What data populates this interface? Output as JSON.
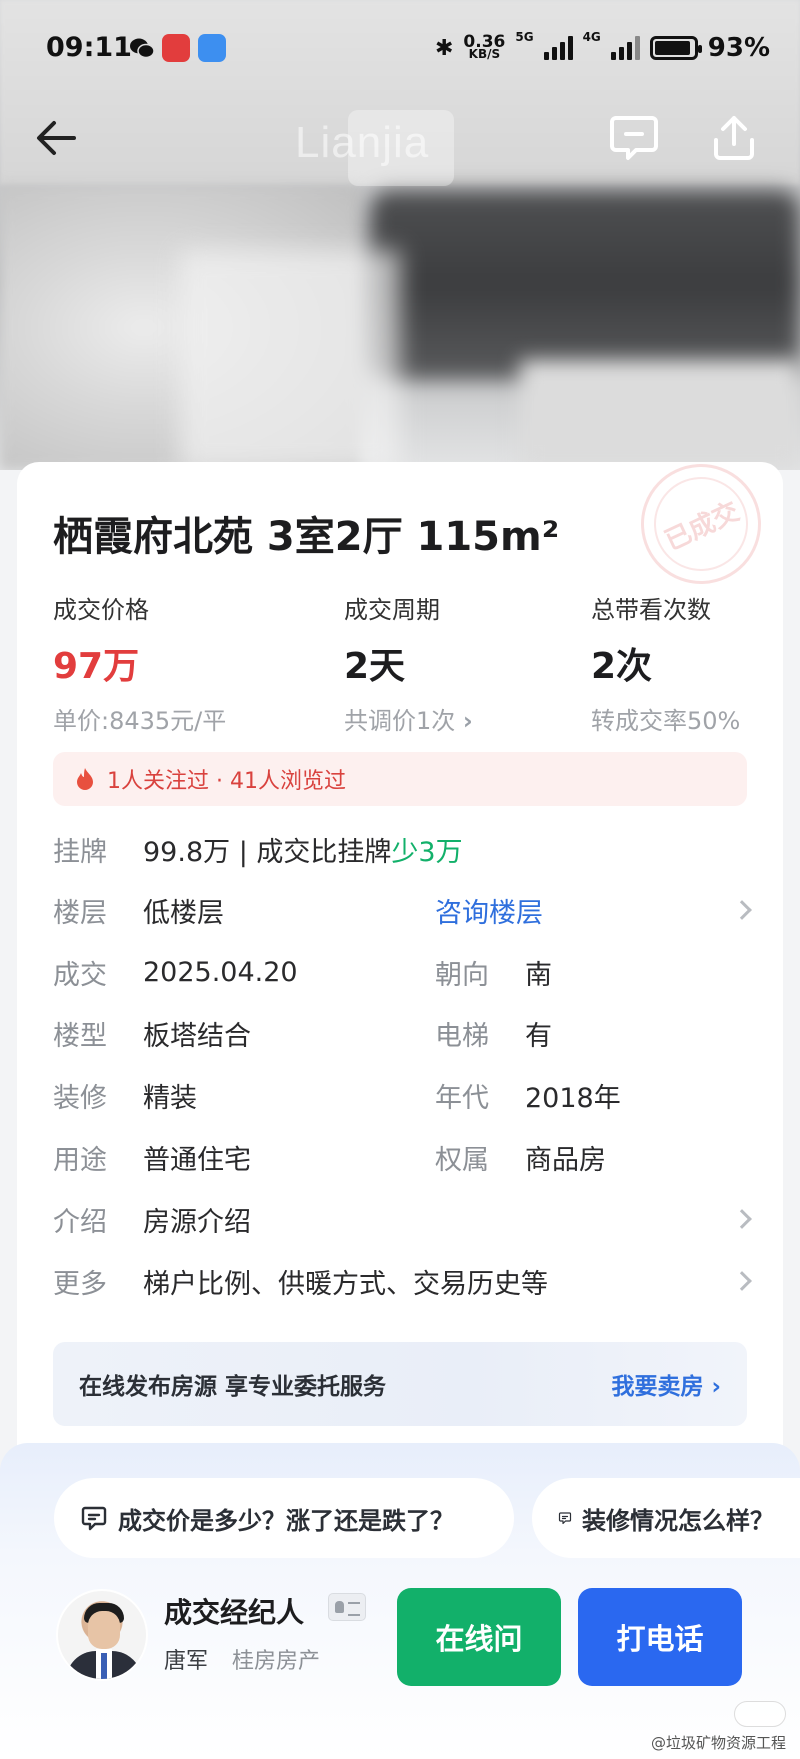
{
  "status_bar": {
    "time": "09:11",
    "net_speed_value": "0.36",
    "net_speed_unit": "KB/S",
    "signal1": "5G",
    "signal2": "4G",
    "battery": "93%"
  },
  "hero": {
    "watermark": "Lianjia"
  },
  "listing": {
    "title": "栖霞府北苑 3室2厅 115m²",
    "stamp": "已成交",
    "stats": [
      {
        "label": "成交价格",
        "value": "97万",
        "sub": "单价:8435元/平"
      },
      {
        "label": "成交周期",
        "value": "2天",
        "sub": "共调价1次"
      },
      {
        "label": "总带看次数",
        "value": "2次",
        "sub": "转成交率50%"
      }
    ],
    "hot": "1人关注过 · 41人浏览过",
    "listing_price": {
      "key": "挂牌",
      "value": "99.8万 | 成交比挂牌",
      "diff": "少3万"
    },
    "floor": {
      "key": "楼层",
      "value": "低楼层",
      "link": "咨询楼层"
    },
    "deal": {
      "key": "成交",
      "value": "2025.04.20"
    },
    "orientation": {
      "key": "朝向",
      "value": "南"
    },
    "building_type": {
      "key": "楼型",
      "value": "板塔结合"
    },
    "elevator": {
      "key": "电梯",
      "value": "有"
    },
    "decoration": {
      "key": "装修",
      "value": "精装"
    },
    "year": {
      "key": "年代",
      "value": "2018年"
    },
    "usage": {
      "key": "用途",
      "value": "普通住宅"
    },
    "ownership": {
      "key": "权属",
      "value": "商品房"
    },
    "intro": {
      "key": "介绍",
      "value": "房源介绍"
    },
    "more": {
      "key": "更多",
      "value": "梯户比例、供暖方式、交易历史等"
    },
    "sell_banner": {
      "text": "在线发布房源 享专业委托服务",
      "action": "我要卖房"
    }
  },
  "questions": [
    "成交价是多少？涨了还是跌了？",
    "装修情况怎么样？"
  ],
  "agent": {
    "title": "成交经纪人",
    "name": "唐军",
    "company": "桂房房产"
  },
  "buttons": {
    "online": "在线问",
    "call": "打电话"
  },
  "credit": "@垃圾矿物资源工程",
  "colors": {
    "red": "#e23d3d",
    "green": "#12b06a",
    "blue": "#2a68f0",
    "link": "#2f6fdd"
  }
}
